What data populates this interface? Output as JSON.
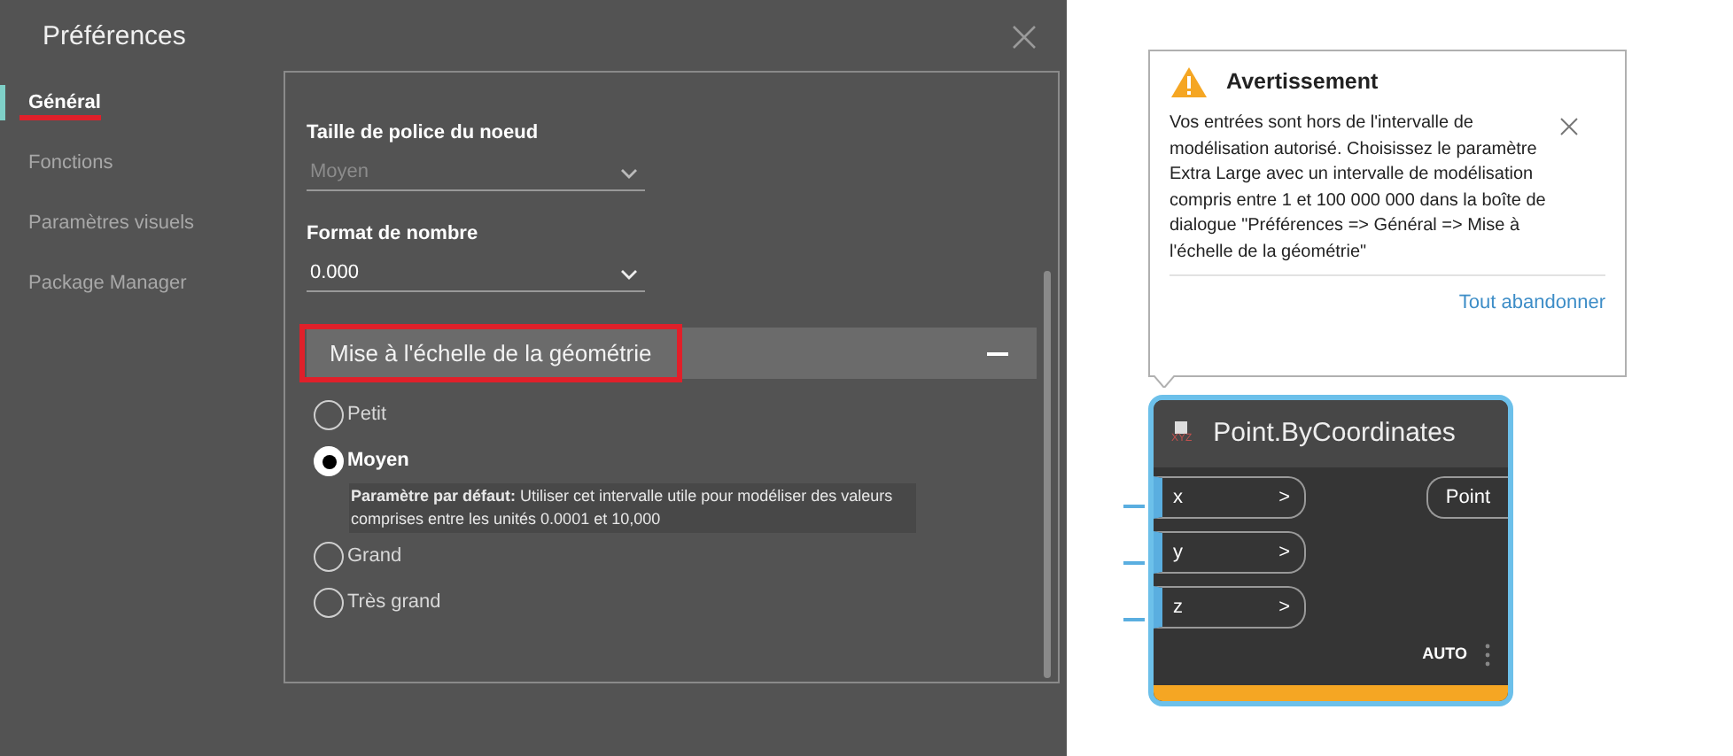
{
  "dialog": {
    "title": "Préférences",
    "sidebar": {
      "items": [
        {
          "label": "Général",
          "selected": true
        },
        {
          "label": "Fonctions",
          "selected": false
        },
        {
          "label": "Paramètres visuels",
          "selected": false
        },
        {
          "label": "Package Manager",
          "selected": false
        }
      ]
    },
    "fields": [
      {
        "label": "Taille de police du noeud",
        "value": "Moyen",
        "disabled": true
      },
      {
        "label": "Format de nombre",
        "value": "0.000",
        "disabled": false
      }
    ],
    "section": {
      "title": "Mise à l'échelle de la géométrie",
      "expanded": true,
      "options": [
        {
          "label": "Petit",
          "selected": false
        },
        {
          "label": "Moyen",
          "selected": true,
          "description": "**Paramètre par défaut:** Utiliser cet intervalle utile pour modéliser des valeurs comprises entre les unités 0.0001 et 10,000"
        },
        {
          "label": "Grand",
          "selected": false
        },
        {
          "label": "Très grand",
          "selected": false
        }
      ]
    }
  },
  "warning": {
    "title": "Avertissement",
    "message": "Vos entrées sont hors de l'intervalle de modélisation autorisé. Choisissez le paramètre Extra Large avec un intervalle de modélisation compris entre 1 et 100 000 000 dans la boîte de dialogue \"Préférences => Général => Mise à l'échelle de la géométrie\"",
    "action": "Tout abandonner"
  },
  "node": {
    "title": "Point.ByCoordinates",
    "icon_label": "XYZ",
    "inputs": [
      {
        "name": "x",
        "arrow": ">"
      },
      {
        "name": "y",
        "arrow": ">"
      },
      {
        "name": "z",
        "arrow": ">"
      }
    ],
    "output": "Point",
    "lacing": "AUTO"
  }
}
